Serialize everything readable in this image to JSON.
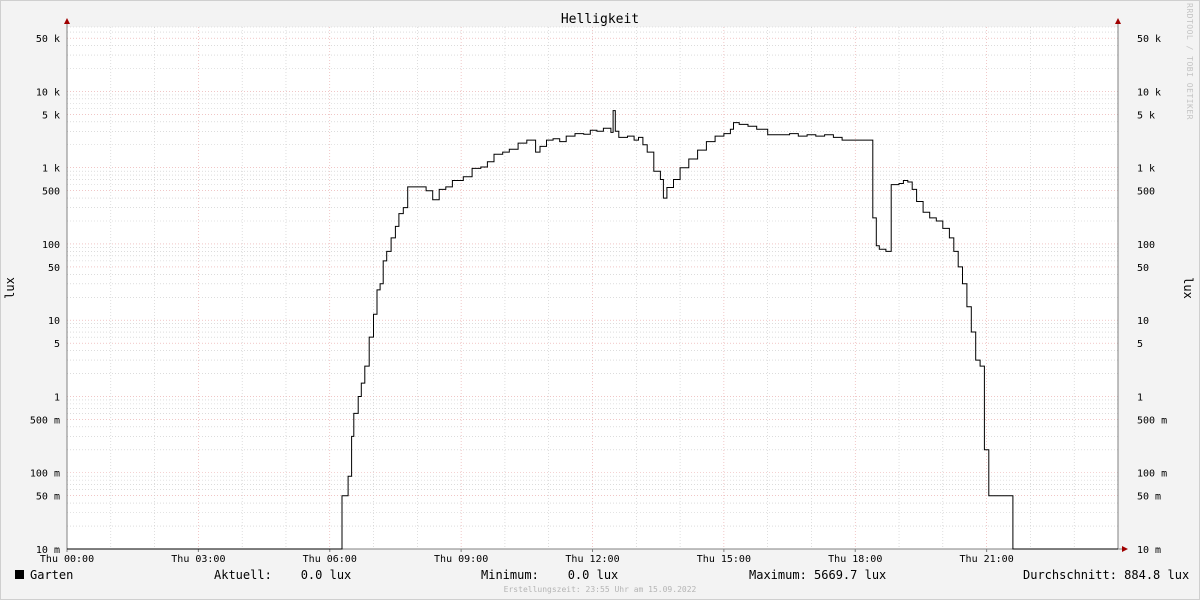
{
  "chart_data": {
    "type": "line",
    "title": "Helligkeit",
    "ylabel": "lux",
    "yscale": "log",
    "ylim": [
      0.01,
      70000
    ],
    "xlim": [
      0,
      24
    ],
    "x_ticks": [
      "Thu 00:00",
      "Thu 03:00",
      "Thu 06:00",
      "Thu 09:00",
      "Thu 12:00",
      "Thu 15:00",
      "Thu 18:00",
      "Thu 21:00"
    ],
    "y_ticks": [
      {
        "value": 50000,
        "label": "50 k"
      },
      {
        "value": 10000,
        "label": "10 k"
      },
      {
        "value": 5000,
        "label": "5 k"
      },
      {
        "value": 1000,
        "label": "1 k"
      },
      {
        "value": 500,
        "label": "500"
      },
      {
        "value": 100,
        "label": "100"
      },
      {
        "value": 50,
        "label": "50"
      },
      {
        "value": 10,
        "label": "10"
      },
      {
        "value": 5,
        "label": "5"
      },
      {
        "value": 1,
        "label": "1"
      },
      {
        "value": 0.5,
        "label": "500 m"
      },
      {
        "value": 0.1,
        "label": "100 m"
      },
      {
        "value": 0.05,
        "label": "50 m"
      },
      {
        "value": 0.01,
        "label": "10 m"
      }
    ],
    "grid": true,
    "series": [
      {
        "name": "Garten",
        "color": "#000000",
        "step": true,
        "points": [
          [
            0.0,
            0.01
          ],
          [
            6.25,
            0.01
          ],
          [
            6.28,
            0.05
          ],
          [
            6.42,
            0.09
          ],
          [
            6.5,
            0.3
          ],
          [
            6.55,
            0.6
          ],
          [
            6.65,
            1.0
          ],
          [
            6.72,
            1.5
          ],
          [
            6.8,
            2.5
          ],
          [
            6.9,
            6
          ],
          [
            7.0,
            12
          ],
          [
            7.08,
            25
          ],
          [
            7.15,
            30
          ],
          [
            7.22,
            60
          ],
          [
            7.3,
            80
          ],
          [
            7.4,
            120
          ],
          [
            7.5,
            170
          ],
          [
            7.58,
            250
          ],
          [
            7.68,
            300
          ],
          [
            7.78,
            560
          ],
          [
            8.2,
            500
          ],
          [
            8.35,
            380
          ],
          [
            8.5,
            520
          ],
          [
            8.65,
            560
          ],
          [
            8.8,
            680
          ],
          [
            9.05,
            760
          ],
          [
            9.25,
            980
          ],
          [
            9.45,
            1020
          ],
          [
            9.6,
            1200
          ],
          [
            9.75,
            1500
          ],
          [
            9.95,
            1600
          ],
          [
            10.1,
            1750
          ],
          [
            10.3,
            2100
          ],
          [
            10.5,
            2300
          ],
          [
            10.7,
            1600
          ],
          [
            10.8,
            1900
          ],
          [
            10.95,
            2300
          ],
          [
            11.1,
            2400
          ],
          [
            11.25,
            2200
          ],
          [
            11.4,
            2600
          ],
          [
            11.6,
            2800
          ],
          [
            11.8,
            2750
          ],
          [
            11.95,
            3100
          ],
          [
            12.1,
            3000
          ],
          [
            12.25,
            3300
          ],
          [
            12.42,
            2900
          ],
          [
            12.47,
            5600
          ],
          [
            12.52,
            3000
          ],
          [
            12.6,
            2500
          ],
          [
            12.8,
            2600
          ],
          [
            12.95,
            2300
          ],
          [
            13.05,
            2500
          ],
          [
            13.15,
            2000
          ],
          [
            13.25,
            1600
          ],
          [
            13.4,
            900
          ],
          [
            13.55,
            700
          ],
          [
            13.62,
            400
          ],
          [
            13.7,
            550
          ],
          [
            13.85,
            700
          ],
          [
            14.0,
            1000
          ],
          [
            14.2,
            1300
          ],
          [
            14.4,
            1700
          ],
          [
            14.6,
            2200
          ],
          [
            14.8,
            2600
          ],
          [
            15.0,
            2800
          ],
          [
            15.15,
            3200
          ],
          [
            15.22,
            3900
          ],
          [
            15.35,
            3700
          ],
          [
            15.55,
            3500
          ],
          [
            15.75,
            3200
          ],
          [
            16.0,
            2700
          ],
          [
            16.3,
            2700
          ],
          [
            16.5,
            2800
          ],
          [
            16.7,
            2600
          ],
          [
            16.9,
            2700
          ],
          [
            17.1,
            2600
          ],
          [
            17.3,
            2700
          ],
          [
            17.5,
            2500
          ],
          [
            17.7,
            2300
          ],
          [
            17.9,
            2300
          ],
          [
            18.1,
            2300
          ],
          [
            18.3,
            2300
          ],
          [
            18.4,
            220
          ],
          [
            18.48,
            95
          ],
          [
            18.55,
            85
          ],
          [
            18.7,
            80
          ],
          [
            18.82,
            600
          ],
          [
            19.0,
            620
          ],
          [
            19.1,
            680
          ],
          [
            19.2,
            650
          ],
          [
            19.3,
            520
          ],
          [
            19.4,
            360
          ],
          [
            19.55,
            260
          ],
          [
            19.7,
            220
          ],
          [
            19.85,
            200
          ],
          [
            20.0,
            160
          ],
          [
            20.15,
            120
          ],
          [
            20.25,
            80
          ],
          [
            20.35,
            50
          ],
          [
            20.45,
            30
          ],
          [
            20.55,
            15
          ],
          [
            20.65,
            7
          ],
          [
            20.75,
            3
          ],
          [
            20.85,
            2.5
          ],
          [
            20.95,
            0.2
          ],
          [
            21.05,
            0.05
          ],
          [
            21.25,
            0.05
          ],
          [
            21.55,
            0.05
          ],
          [
            21.6,
            0.01
          ],
          [
            24.0,
            0.01
          ]
        ]
      }
    ]
  },
  "legend": {
    "series_name": "Garten",
    "current": "Aktuell:    0.0 lux",
    "minimum": "Minimum:    0.0 lux",
    "maximum": "Maximum: 5669.7 lux",
    "average": "Durchschnitt: 884.8 lux"
  },
  "footer": "Erstellungszeit: 23:55 Uhr am 15.09.2022",
  "watermark": "RRDTOOL / TOBI OETIKER"
}
